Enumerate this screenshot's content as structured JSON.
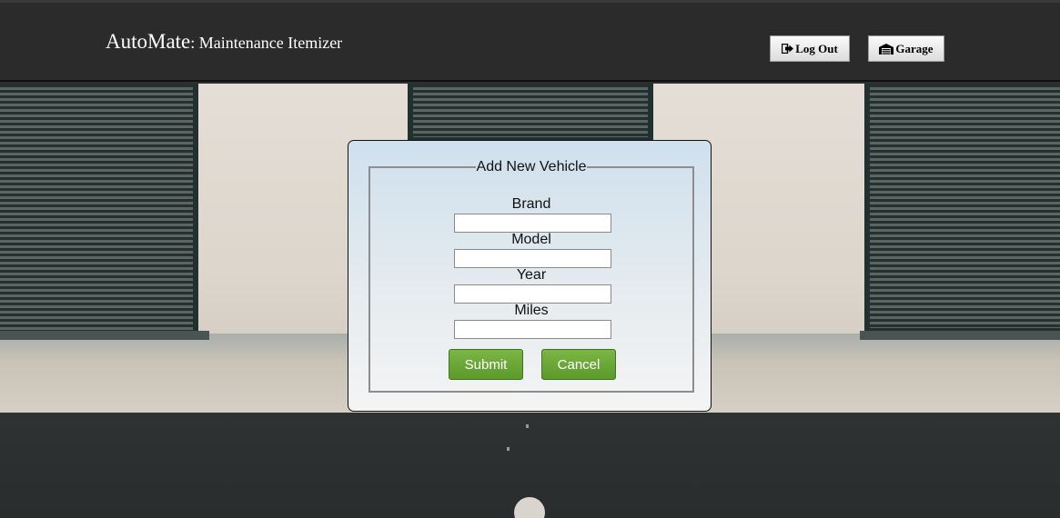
{
  "header": {
    "app_name": "AutoMate",
    "subtitle": ": Maintenance Itemizer",
    "logout_label": "Log Out",
    "logout_icon": "sign-out-icon",
    "garage_label": "Garage",
    "garage_icon": "warehouse-icon"
  },
  "form": {
    "legend": "Add New Vehicle",
    "fields": [
      {
        "label": "Brand",
        "value": ""
      },
      {
        "label": "Model",
        "value": ""
      },
      {
        "label": "Year",
        "value": ""
      },
      {
        "label": "Miles",
        "value": ""
      }
    ],
    "submit_label": "Submit",
    "cancel_label": "Cancel"
  },
  "colors": {
    "header_bg": "#2b2b2b",
    "button_green": "#6aaa38"
  }
}
